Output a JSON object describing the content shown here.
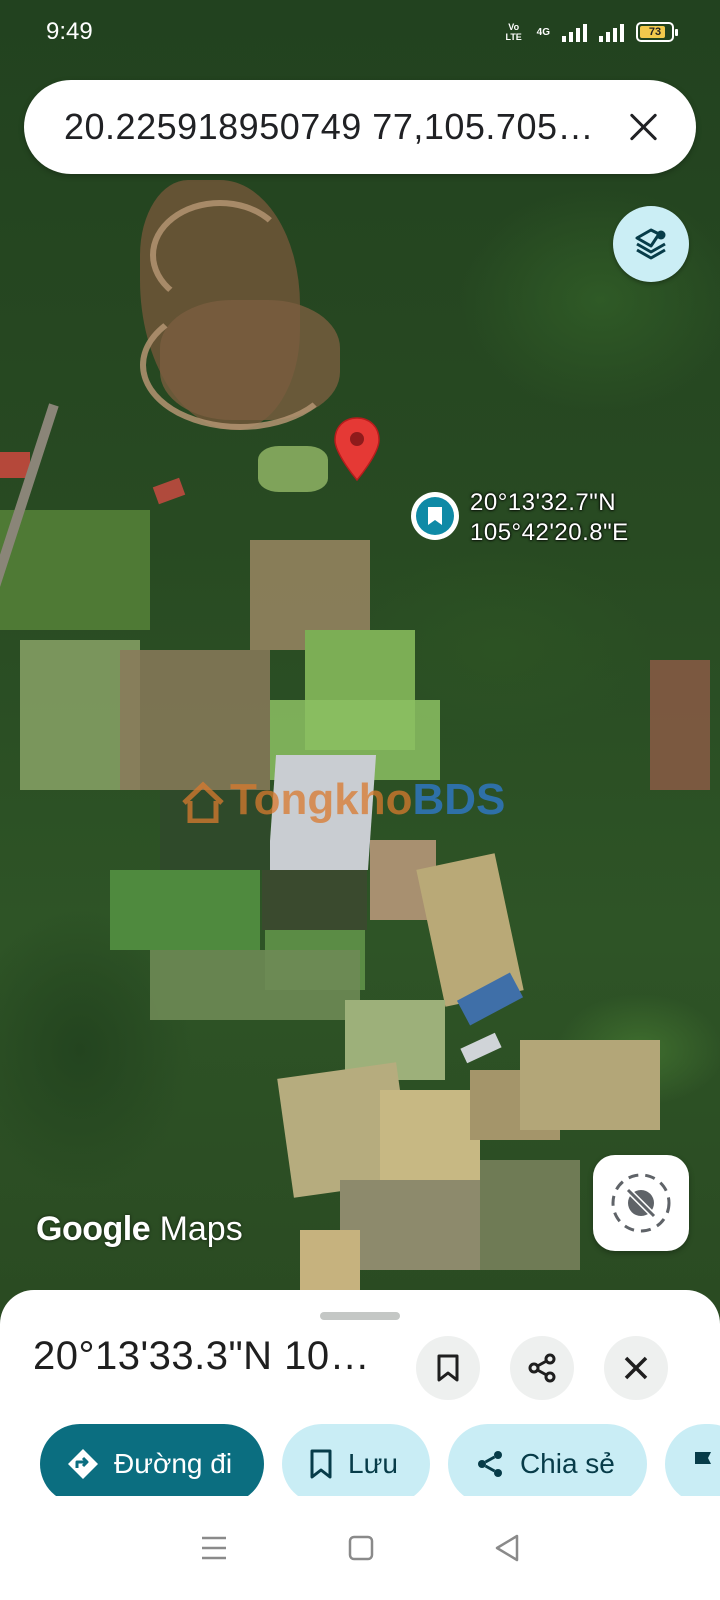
{
  "status_bar": {
    "time": "9:49",
    "volte": "Vo LTE",
    "network": "4G",
    "battery": "73"
  },
  "search": {
    "query": "20.225918950749 77,105.705…"
  },
  "map": {
    "coordinate_label_lat": "20°13'32.7\"N",
    "coordinate_label_lng": "105°42'20.8\"E",
    "watermark_part1": "Tongkho",
    "watermark_part2": "BDS",
    "logo_google": "Google",
    "logo_maps": "Maps"
  },
  "sheet": {
    "title": "20°13'33.3\"N 10…",
    "actions": {
      "directions_label": "Đường đi",
      "save_label": "Lưu",
      "share_label": "Chia sẻ"
    }
  },
  "colors": {
    "primary": "#0b6e80",
    "chip_secondary": "#c9edf5",
    "pin": "#e53935"
  }
}
